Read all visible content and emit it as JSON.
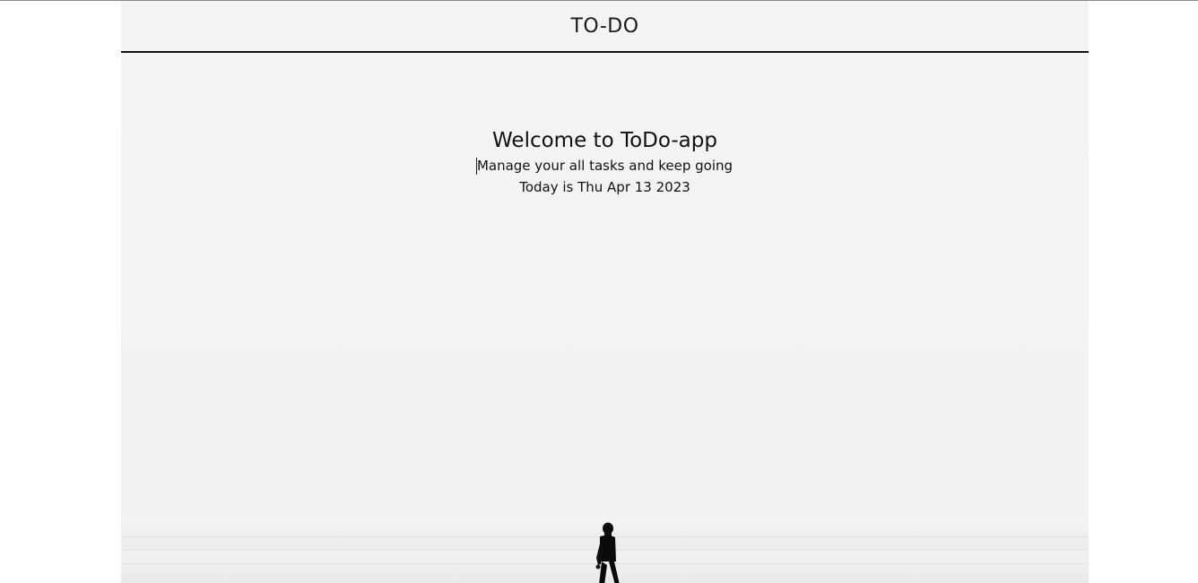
{
  "header": {
    "title": "TO-DO"
  },
  "hero": {
    "heading": "Welcome to ToDo-app",
    "tagline": "Manage your all tasks and keep going",
    "date_text": "Today is Thu Apr 13 2023"
  },
  "background": {
    "image": "person-walking-on-snowfield"
  }
}
